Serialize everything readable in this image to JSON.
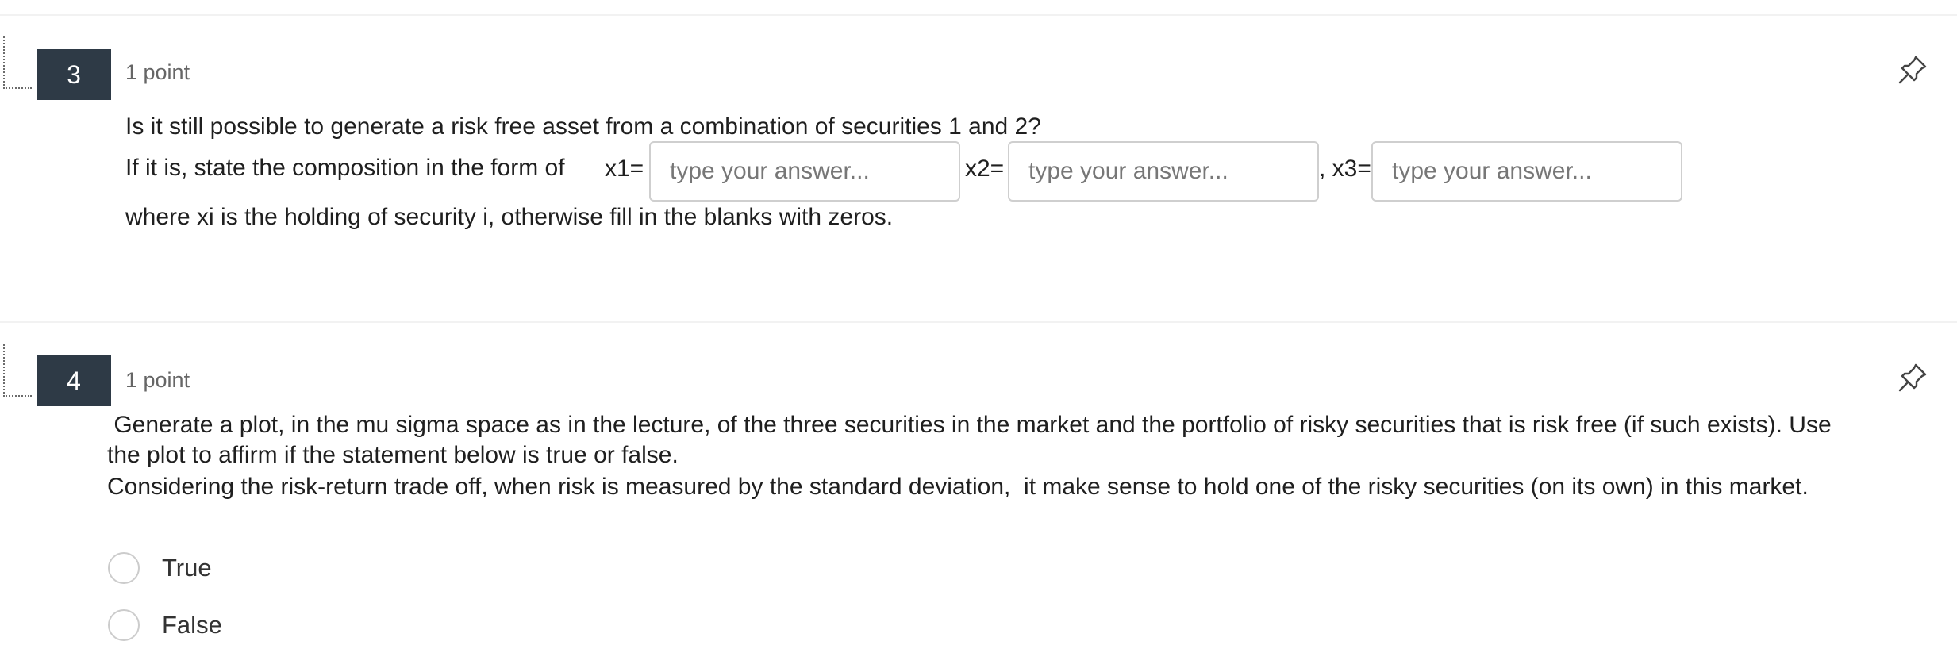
{
  "colors": {
    "number_badge_bg": "#2e3a46",
    "number_badge_text": "#ffffff",
    "points_text": "#666666",
    "input_border": "#cfcfcf",
    "radio_border": "#cccccc"
  },
  "q3": {
    "number": "3",
    "points": "1 point",
    "pin_icon": "pin-icon",
    "line1": "Is it still possible to generate a risk free asset from a combination of securities 1 and 2?",
    "line2_prefix": "If it is, state the composition in the form of",
    "x1_label": "x1=",
    "x2_label": "x2=",
    "x3_label": ", x3=",
    "x1_placeholder": "type your answer...",
    "x2_placeholder": "type your answer...",
    "x3_placeholder": "type your answer...",
    "line3": "where xi is the holding of security i, otherwise fill in the blanks with zeros."
  },
  "q4": {
    "number": "4",
    "points": "1 point",
    "pin_icon": "pin-icon",
    "line1": " Generate a plot, in the mu sigma space as in the lecture, of the three securities in the market and the portfolio of risky securities that is risk free (if such exists). Use",
    "line2": "the plot to affirm if the statement below is true or false.",
    "line3": "Considering the risk-return trade off, when risk is measured by the standard deviation,  it make sense to hold one of the risky securities (on its own) in this market.",
    "options": [
      {
        "label": "True"
      },
      {
        "label": "False"
      }
    ]
  }
}
